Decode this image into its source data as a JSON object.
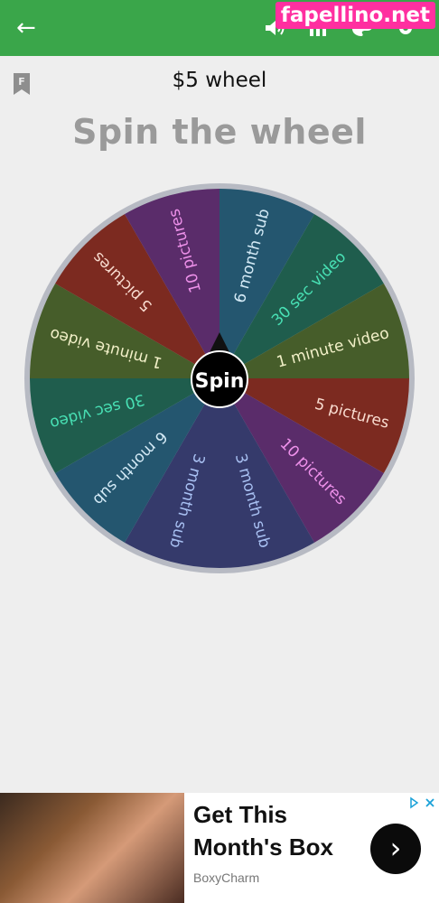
{
  "topbar": {
    "back_icon": "arrow-left-icon",
    "sound_icon": "volume-icon",
    "list_icon": "list-icon",
    "theme_icon": "palette-icon",
    "settings_icon": "gear-icon",
    "color": "#3aa64a"
  },
  "watermark": "fapellino.net",
  "wheel_title": "$5 wheel",
  "heading": "Spin the wheel",
  "wheel": {
    "center_label": "Spin",
    "segments": [
      {
        "label": "6 month sub",
        "color": "#24566f",
        "text_color": "#d4eaf6"
      },
      {
        "label": "30 sec video",
        "color": "#1f5d4d",
        "text_color": "#48e0b4"
      },
      {
        "label": "1 minute video",
        "color": "#465d2a",
        "text_color": "#f2f0c8"
      },
      {
        "label": "5 pictures",
        "color": "#7c2a20",
        "text_color": "#f8dbcf"
      },
      {
        "label": "10 pictures",
        "color": "#5a2c6a",
        "text_color": "#ee91ea"
      },
      {
        "label": "3 month sub",
        "color": "#353a6b",
        "text_color": "#a8c0f2"
      },
      {
        "label": "3 month sub",
        "color": "#353a6b",
        "text_color": "#a8c0f2"
      },
      {
        "label": "6 month sub",
        "color": "#24566f",
        "text_color": "#d4eaf6"
      },
      {
        "label": "30 sec video",
        "color": "#1f5d4d",
        "text_color": "#48e0b4"
      },
      {
        "label": "1 minute video",
        "color": "#465d2a",
        "text_color": "#f2f0c8"
      },
      {
        "label": "5 pictures",
        "color": "#7c2a20",
        "text_color": "#f8dbcf"
      },
      {
        "label": "10 pictures",
        "color": "#5a2c6a",
        "text_color": "#ee91ea"
      }
    ]
  },
  "ad": {
    "title": "Get This Month's Box",
    "brand": "BoxyCharm",
    "next_icon": "chevron-right-icon",
    "adchoices_icon": "adchoices-icon"
  }
}
